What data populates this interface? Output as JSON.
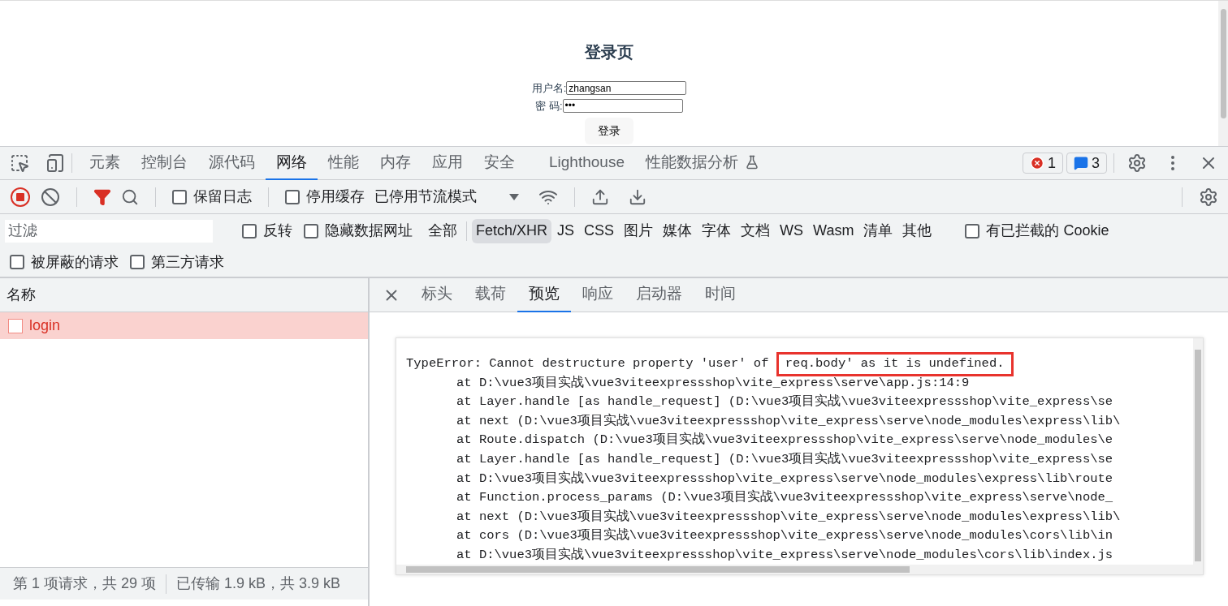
{
  "page": {
    "title": "登录页",
    "fields": [
      {
        "label": "用户名:",
        "value": "zhangsan"
      },
      {
        "label": "密 码:",
        "value": "•••"
      }
    ],
    "button": "登录"
  },
  "devtools": {
    "tabs": [
      {
        "label": "元素",
        "selected": false,
        "kind": "plain"
      },
      {
        "label": "控制台",
        "selected": false,
        "kind": "plain"
      },
      {
        "label": "源代码",
        "selected": false,
        "kind": "plain"
      },
      {
        "label": "网络",
        "selected": true,
        "kind": "plain"
      },
      {
        "label": "性能",
        "selected": false,
        "kind": "plain"
      },
      {
        "label": "内存",
        "selected": false,
        "kind": "plain"
      },
      {
        "label": "应用",
        "selected": false,
        "kind": "plain"
      },
      {
        "label": "安全",
        "selected": false,
        "kind": "plain"
      },
      {
        "label": "Lighthouse",
        "selected": false,
        "kind": "plain"
      },
      {
        "label": "性能数据分析",
        "selected": false,
        "kind": "experimental"
      }
    ],
    "error_count": "1",
    "message_count": "3"
  },
  "toolbar": {
    "recording": true,
    "options": [
      {
        "label": "保留日志",
        "checked": false
      },
      {
        "label": "停用缓存",
        "checked": false
      }
    ],
    "throttling": "已停用节流模式"
  },
  "filter": {
    "placeholder": "过滤",
    "options": [
      {
        "label": "反转",
        "checked": false
      },
      {
        "label": "隐藏数据网址",
        "checked": false
      }
    ],
    "types": [
      {
        "label": "全部",
        "selected": false
      },
      {
        "label": "Fetch/XHR",
        "selected": true
      },
      {
        "label": "JS",
        "selected": false
      },
      {
        "label": "CSS",
        "selected": false
      },
      {
        "label": "图片",
        "selected": false
      },
      {
        "label": "媒体",
        "selected": false
      },
      {
        "label": "字体",
        "selected": false
      },
      {
        "label": "文档",
        "selected": false
      },
      {
        "label": "WS",
        "selected": false
      },
      {
        "label": "Wasm",
        "selected": false
      },
      {
        "label": "清单",
        "selected": false
      },
      {
        "label": "其他",
        "selected": false
      }
    ],
    "blocked_cookies": {
      "label": "有已拦截的 Cookie",
      "checked": false
    },
    "second_row": [
      {
        "label": "被屏蔽的请求",
        "checked": false
      },
      {
        "label": "第三方请求",
        "checked": false
      }
    ]
  },
  "requests": {
    "column": "名称",
    "rows": [
      {
        "name": "login",
        "selected": true,
        "failed": true
      }
    ]
  },
  "detail_tabs": [
    {
      "label": "标头",
      "selected": false
    },
    {
      "label": "载荷",
      "selected": false
    },
    {
      "label": "预览",
      "selected": true
    },
    {
      "label": "响应",
      "selected": false
    },
    {
      "label": "启动器",
      "selected": false
    },
    {
      "label": "时间",
      "selected": false
    }
  ],
  "preview": {
    "first_line": "TypeError: Cannot destructure property 'user' of ",
    "highlighted": "req.body' as it is undefined.",
    "lines": [
      "at D:\\vue3项目实战\\vue3viteexpressshop\\vite_express\\serve\\app.js:14:9",
      "at Layer.handle [as handle_request] (D:\\vue3项目实战\\vue3viteexpressshop\\vite_express\\se",
      "at next (D:\\vue3项目实战\\vue3viteexpressshop\\vite_express\\serve\\node_modules\\express\\lib\\",
      "at Route.dispatch (D:\\vue3项目实战\\vue3viteexpressshop\\vite_express\\serve\\node_modules\\e",
      "at Layer.handle [as handle_request] (D:\\vue3项目实战\\vue3viteexpressshop\\vite_express\\se",
      "at D:\\vue3项目实战\\vue3viteexpressshop\\vite_express\\serve\\node_modules\\express\\lib\\route",
      "at Function.process_params (D:\\vue3项目实战\\vue3viteexpressshop\\vite_express\\serve\\node_",
      "at next (D:\\vue3项目实战\\vue3viteexpressshop\\vite_express\\serve\\node_modules\\express\\lib\\",
      "at cors (D:\\vue3项目实战\\vue3viteexpressshop\\vite_express\\serve\\node_modules\\cors\\lib\\in",
      "at D:\\vue3项目实战\\vue3viteexpressshop\\vite_express\\serve\\node_modules\\cors\\lib\\index.js"
    ]
  },
  "status_bar": [
    "第 1 项请求，共 29 项",
    "已传输 1.9 kB，共 3.9 kB"
  ]
}
